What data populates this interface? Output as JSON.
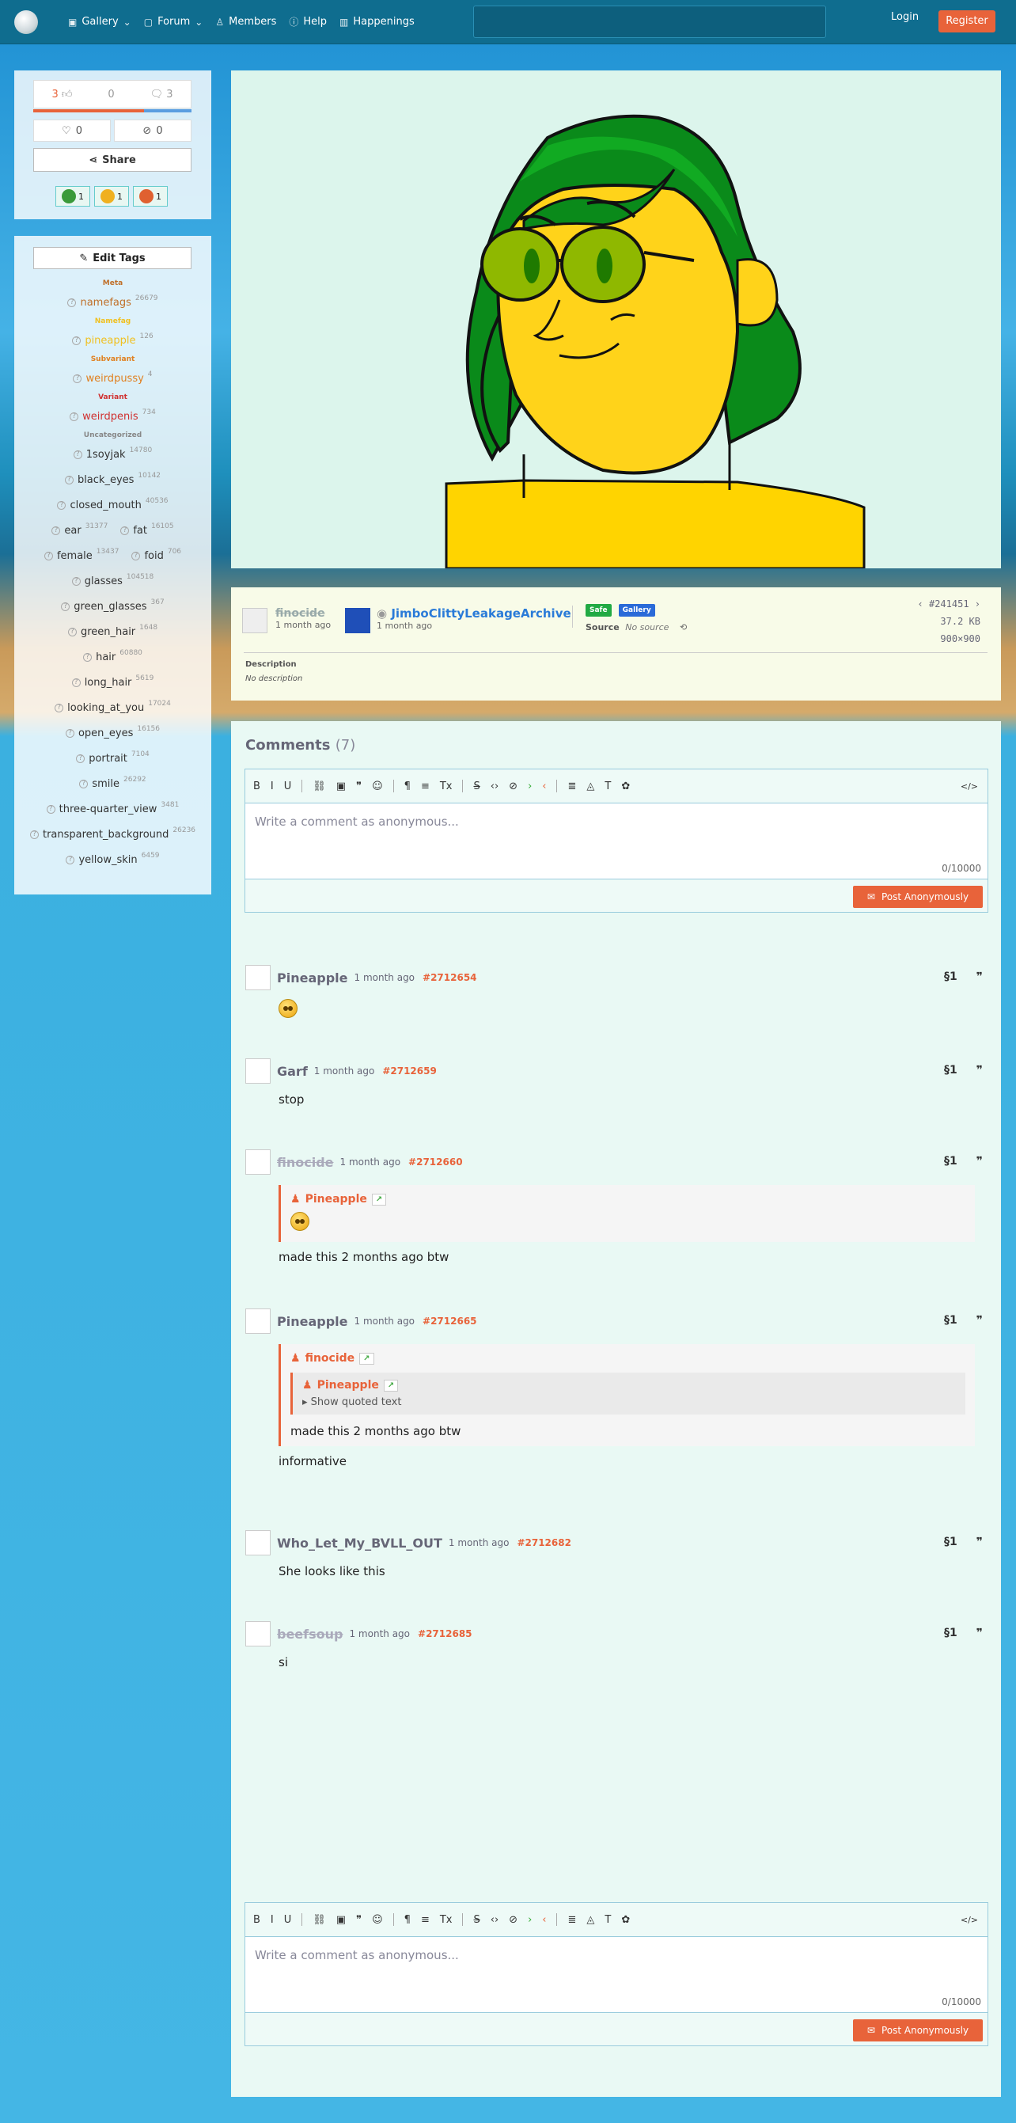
{
  "nav": {
    "gallery": "Gallery",
    "forum": "Forum",
    "members": "Members",
    "help": "Help",
    "happenings": "Happenings",
    "login": "Login",
    "register": "Register"
  },
  "votes": {
    "up": "3",
    "score": "0",
    "down": "3",
    "faves": "0",
    "hides": "0",
    "upvote_fraction": 0.7
  },
  "share_label": "Share",
  "reactions": [
    {
      "icon": "green-face-icon",
      "count": "1",
      "color": "#3a9a3a"
    },
    {
      "icon": "thinking-face-icon",
      "count": "1",
      "color": "#f0b020"
    },
    {
      "icon": "hot-face-icon",
      "count": "1",
      "color": "#e06030"
    }
  ],
  "edit_tags_label": "Edit Tags",
  "tag_groups": [
    {
      "category": "Meta",
      "color": "#c0702a",
      "tags": [
        {
          "name": "namefags",
          "count": "26679"
        }
      ]
    },
    {
      "category": "Namefag",
      "color": "#f0c020",
      "tags": [
        {
          "name": "pineapple",
          "count": "126"
        }
      ]
    },
    {
      "category": "Subvariant",
      "color": "#e08020",
      "tags": [
        {
          "name": "weirdpussy",
          "count": "4"
        }
      ]
    },
    {
      "category": "Variant",
      "color": "#d03030",
      "tags": [
        {
          "name": "weirdpenis",
          "count": "734"
        }
      ]
    },
    {
      "category": "Uncategorized",
      "color": "#888888",
      "rows": [
        [
          {
            "name": "1soyjak",
            "count": "14780"
          }
        ],
        [
          {
            "name": "black_eyes",
            "count": "10142"
          }
        ],
        [
          {
            "name": "closed_mouth",
            "count": "40536"
          }
        ],
        [
          {
            "name": "ear",
            "count": "31377"
          },
          {
            "name": "fat",
            "count": "16105"
          }
        ],
        [
          {
            "name": "female",
            "count": "13437"
          },
          {
            "name": "foid",
            "count": "706"
          }
        ],
        [
          {
            "name": "glasses",
            "count": "104518"
          }
        ],
        [
          {
            "name": "green_glasses",
            "count": "367"
          }
        ],
        [
          {
            "name": "green_hair",
            "count": "1648"
          }
        ],
        [
          {
            "name": "hair",
            "count": "60880"
          }
        ],
        [
          {
            "name": "long_hair",
            "count": "5619"
          }
        ],
        [
          {
            "name": "looking_at_you",
            "count": "17024"
          }
        ],
        [
          {
            "name": "open_eyes",
            "count": "16156"
          }
        ],
        [
          {
            "name": "portrait",
            "count": "7104"
          }
        ],
        [
          {
            "name": "smile",
            "count": "26292"
          }
        ],
        [
          {
            "name": "three-quarter_view",
            "count": "3481"
          }
        ],
        [
          {
            "name": "transparent_background",
            "count": "26236"
          }
        ],
        [
          {
            "name": "yellow_skin",
            "count": "6459"
          }
        ]
      ]
    }
  ],
  "info": {
    "uploader": "finocide",
    "uploader_time": "1 month ago",
    "artist": "JimboClittyLeakageArchive",
    "artist_time": "1 month ago",
    "rating": "Safe",
    "gallery": "Gallery",
    "source_label": "Source",
    "source_value": "No source",
    "post_id": "#241451",
    "size": "37.2 KB",
    "dims": "900×900",
    "desc_label": "Description",
    "desc_value": "No description"
  },
  "comments_title": "Comments",
  "comments_count": "(7)",
  "editor": {
    "placeholder": "Write a comment as anonymous...",
    "counter": "0/10000",
    "post_label": "Post Anonymously"
  },
  "comments": [
    {
      "name": "Pineapple",
      "time": "1 month ago",
      "id": "#2712654",
      "body": ""
    },
    {
      "name": "Garf",
      "time": "1 month ago",
      "id": "#2712659",
      "body": "stop"
    },
    {
      "name": "finocide",
      "time": "1 month ago",
      "id": "#2712660",
      "body": "made this 2 months ago btw",
      "quote_name": "Pineapple"
    },
    {
      "name": "Pineapple",
      "time": "1 month ago",
      "id": "#2712665",
      "body": "informative",
      "quote_name": "finocide",
      "inner_quote_name": "Pineapple",
      "show_quoted": "Show quoted text",
      "quote_body": "made this 2 months ago btw"
    },
    {
      "name": "Who_Let_My_BVLL_OUT",
      "time": "1 month ago",
      "id": "#2712682",
      "body": "She looks like this"
    },
    {
      "name": "beefsoup",
      "time": "1 month ago",
      "id": "#2712685",
      "body": "si"
    }
  ]
}
